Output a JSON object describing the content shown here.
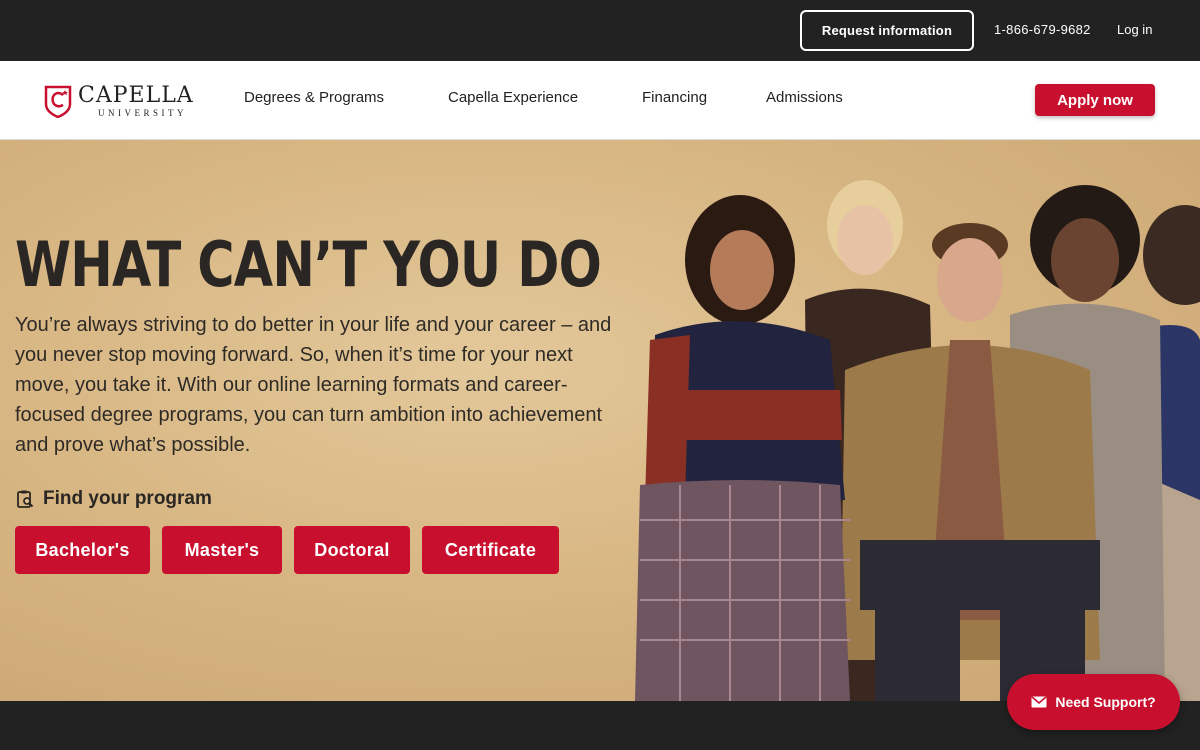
{
  "topbar": {
    "request_label": "Request information",
    "phone": "1-866-679-9682",
    "login_label": "Log in"
  },
  "brand": {
    "name": "CAPELLA",
    "sub": "UNIVERSITY",
    "color": "#c8102e"
  },
  "nav": {
    "items": [
      {
        "label": "Degrees & Programs"
      },
      {
        "label": "Capella Experience"
      },
      {
        "label": "Financing"
      },
      {
        "label": "Admissions"
      }
    ],
    "apply_label": "Apply now"
  },
  "hero": {
    "headline": "WHAT CAN’T YOU DO",
    "body": "You’re always striving to do better in your life and your career – and you never stop moving forward. So, when it’s time for your next move, you take it. With our online learning formats and career-focused degree programs, you can turn ambition into achievement and prove what’s possible.",
    "find_label": "Find your program",
    "find_icon": "clipboard-search-icon",
    "programs": [
      {
        "label": "Bachelor's"
      },
      {
        "label": "Master's"
      },
      {
        "label": "Doctoral"
      },
      {
        "label": "Certificate"
      }
    ]
  },
  "support": {
    "label": "Need Support?",
    "icon": "envelope-icon"
  },
  "colors": {
    "accent": "#c8102e",
    "dark": "#222222",
    "hero_bg": "#d8b784"
  }
}
